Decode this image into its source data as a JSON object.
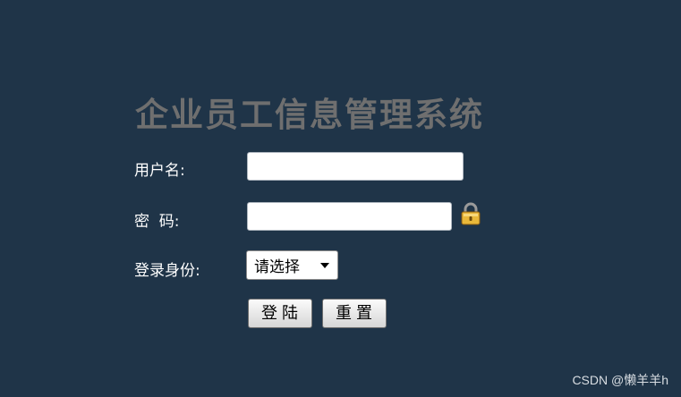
{
  "title": "企业员工信息管理系统",
  "form": {
    "username_label": "用户名:",
    "username_value": "",
    "password_label": "密  码:",
    "password_value": "",
    "role_label": "登录身份:",
    "role_selected": "请选择",
    "login_button": "登陆",
    "reset_button": "重置"
  },
  "icons": {
    "password_icon": "lock-icon",
    "select_arrow": "chevron-down-icon"
  },
  "colors": {
    "background": "#1f3448",
    "title": "#6f6f6f",
    "label": "#ffffff"
  },
  "watermark": "CSDN @懒羊羊h"
}
